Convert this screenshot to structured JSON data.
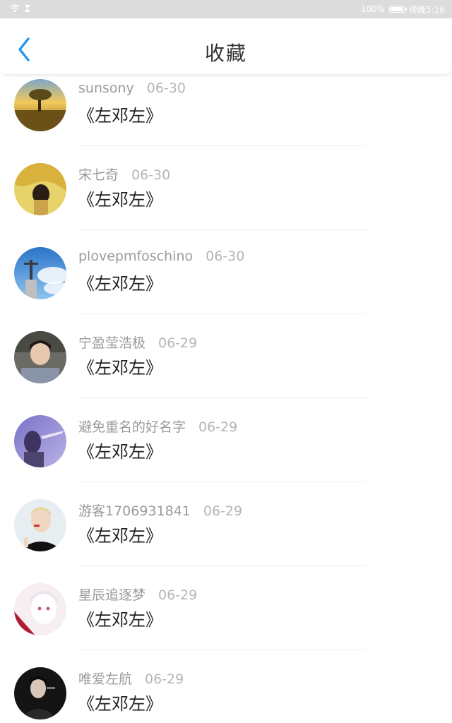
{
  "status_bar": {
    "battery": "100%",
    "battery_level": 1.0,
    "carrier_time": "傍晚5:16"
  },
  "header": {
    "title": "收藏",
    "back_icon": "chevron-left-icon",
    "accent": "#2196f3"
  },
  "favorites": [
    {
      "user": "sunsony",
      "date": "06-30",
      "title": "《左邓左》"
    },
    {
      "user": "宋七奇",
      "date": "06-30",
      "title": "《左邓左》"
    },
    {
      "user": "plovepmfoschino",
      "date": "06-30",
      "title": "《左邓左》"
    },
    {
      "user": "宁盈莹浩极",
      "date": "06-29",
      "title": "《左邓左》"
    },
    {
      "user": "避免重名的好名字",
      "date": "06-29",
      "title": "《左邓左》"
    },
    {
      "user": "游客1706931841",
      "date": "06-29",
      "title": "《左邓左》"
    },
    {
      "user": "星辰追逐梦",
      "date": "06-29",
      "title": "《左邓左》"
    },
    {
      "user": "唯爱左航",
      "date": "06-29",
      "title": "《左邓左》"
    }
  ]
}
